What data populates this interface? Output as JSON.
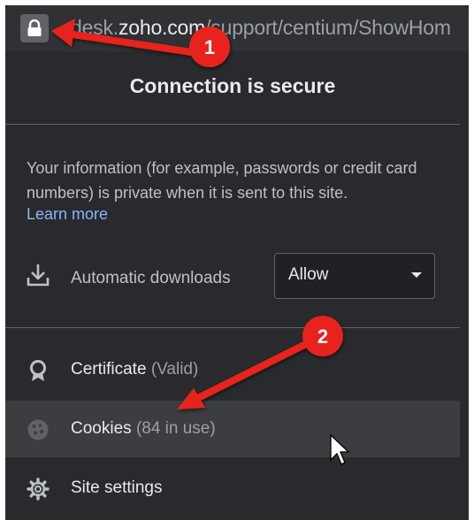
{
  "address_bar": {
    "url_prefix": "desk.",
    "url_domain": "zoho.com",
    "url_path": "/support/centium/ShowHom",
    "lock_icon": "lock-icon"
  },
  "popup": {
    "title": "Connection is secure",
    "info_text": "Your information (for example, passwords or credit card numbers) is private when it is sent to this site.",
    "learn_more": "Learn more",
    "downloads": {
      "icon": "download-icon",
      "label": "Automatic downloads",
      "selected": "Allow"
    },
    "items": [
      {
        "label": "Certificate",
        "status": "(Valid)",
        "icon": "certificate-icon"
      },
      {
        "label": "Cookies",
        "status": "(84 in use)",
        "icon": "cookie-icon"
      },
      {
        "label": "Site settings",
        "status": "",
        "icon": "gear-icon"
      }
    ]
  },
  "annotations": [
    {
      "number": "1"
    },
    {
      "number": "2"
    }
  ],
  "colors": {
    "annotation_red": "#e8231f",
    "link": "#8ab4f8",
    "popup_bg": "#292a2d"
  }
}
